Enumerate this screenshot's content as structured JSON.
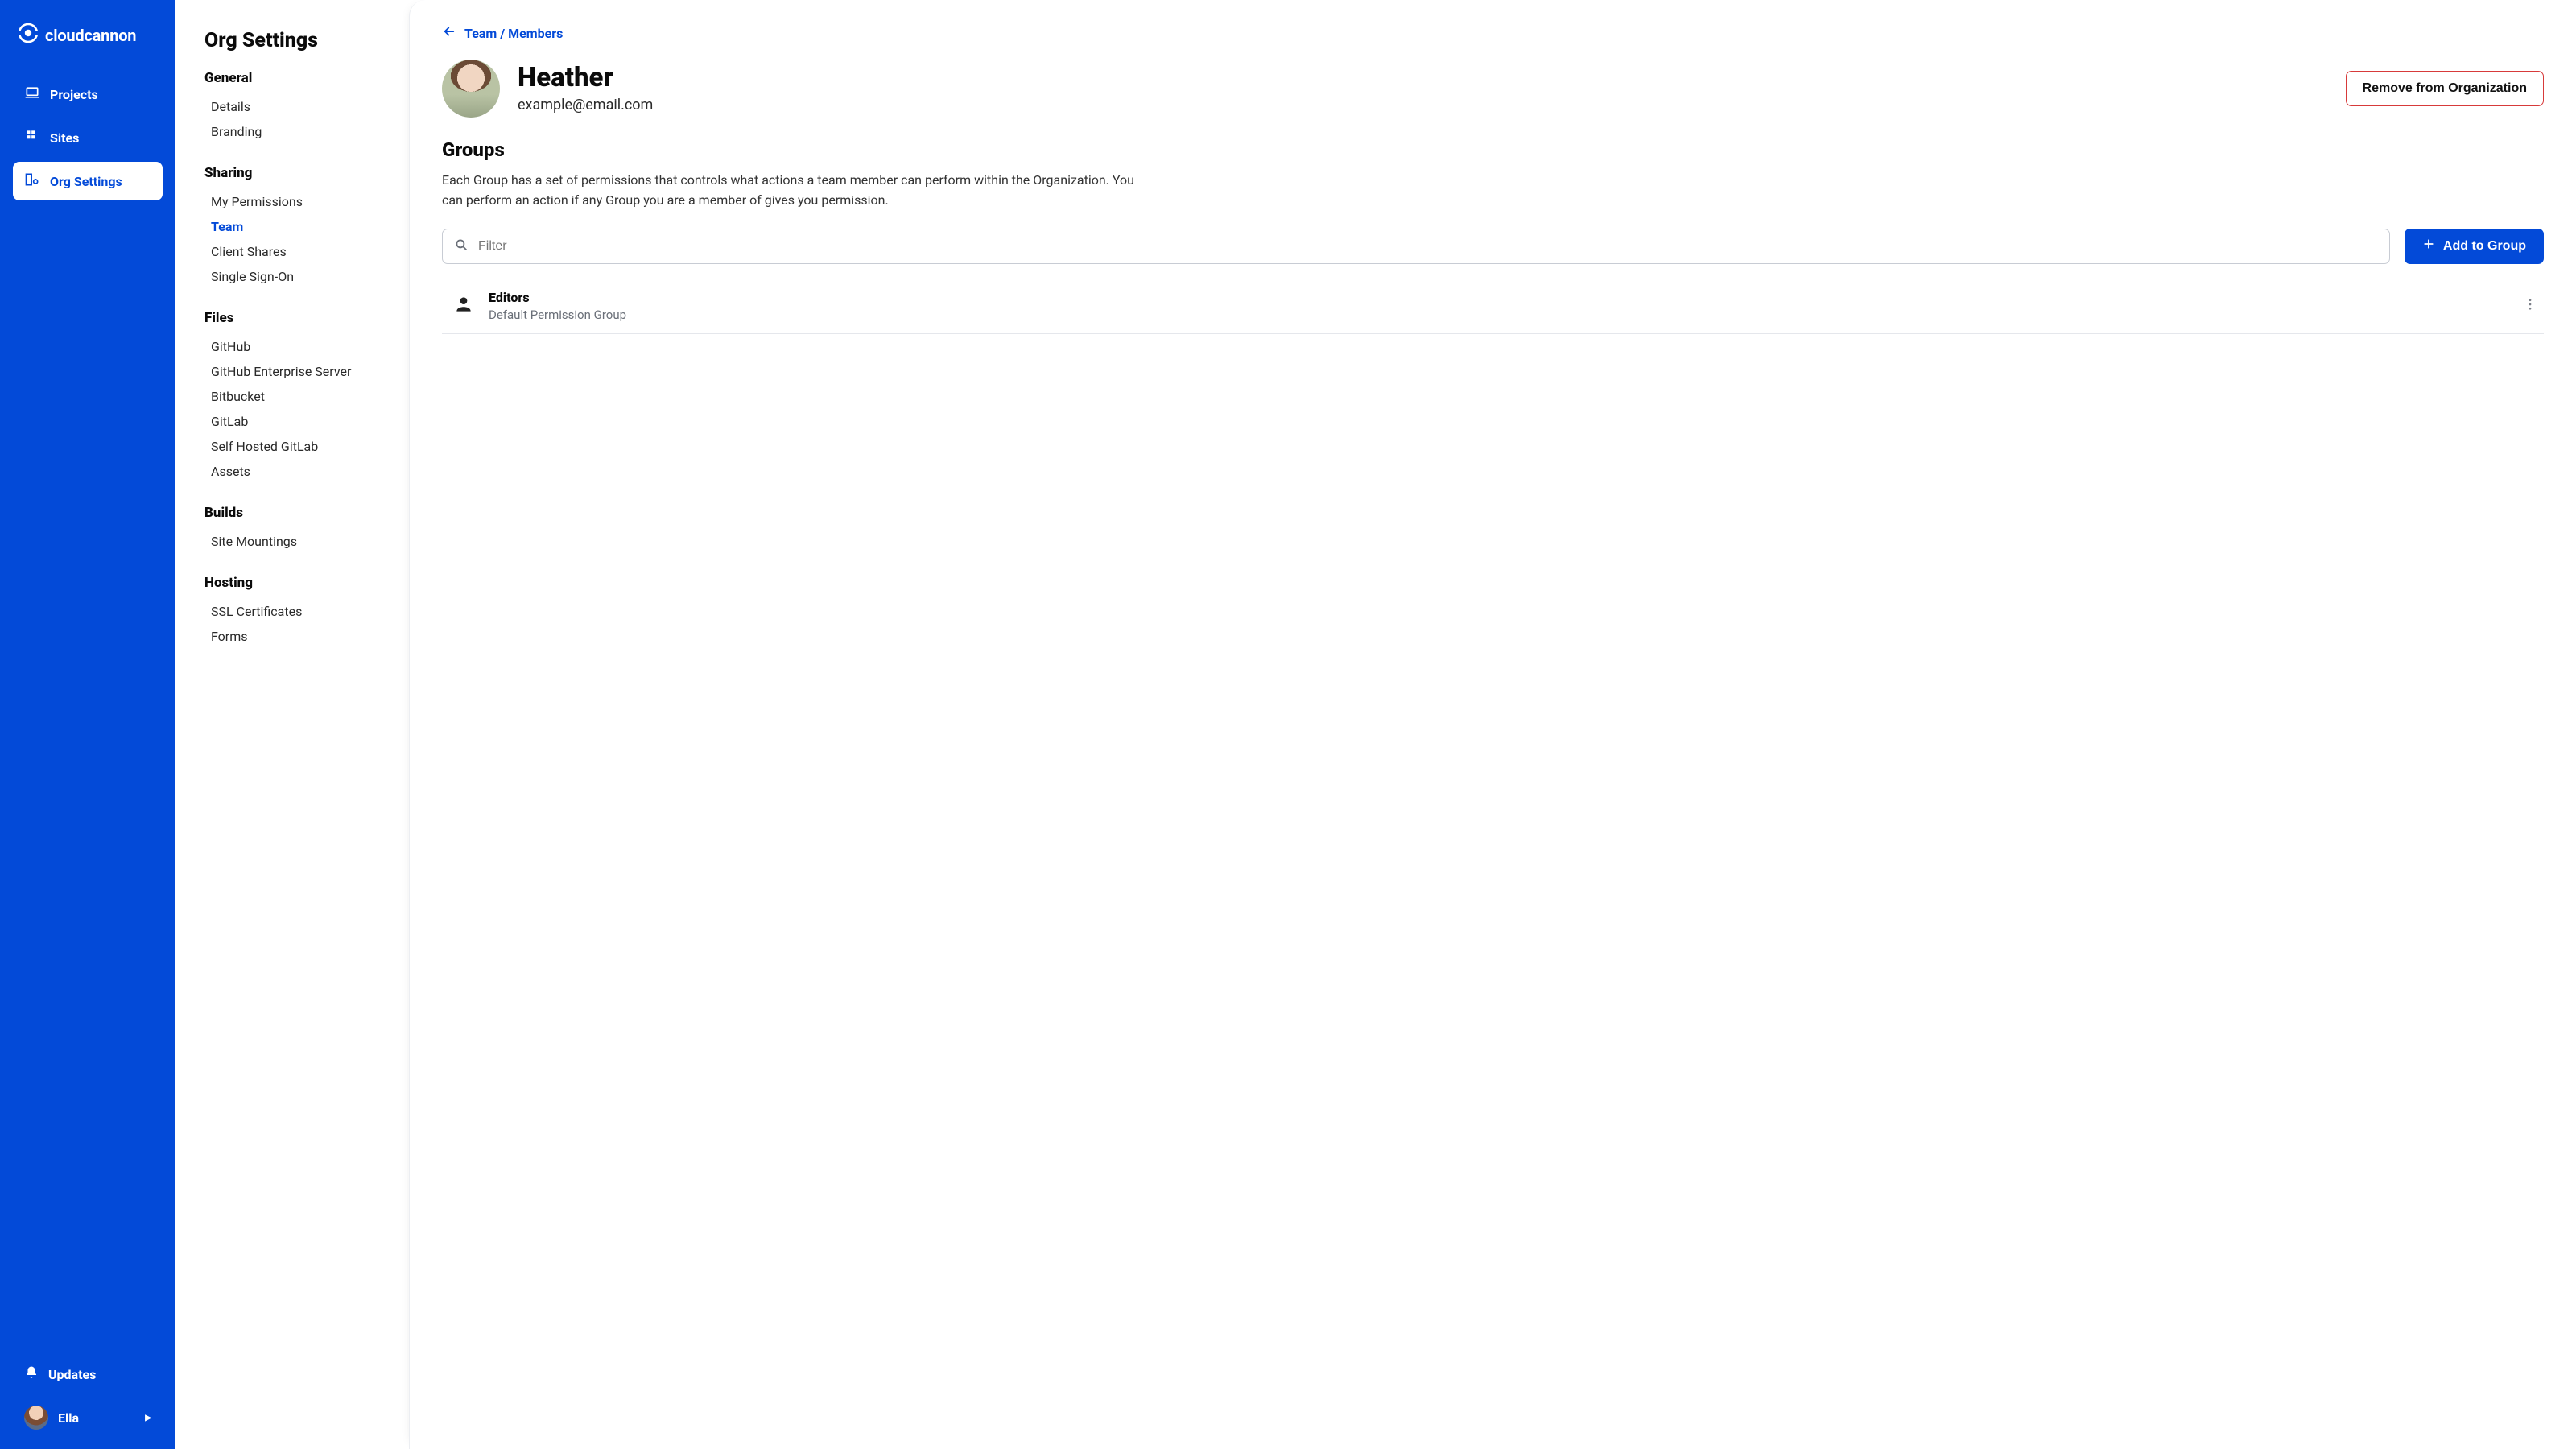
{
  "brand": {
    "name": "cloudcannon"
  },
  "primary_nav": {
    "items": [
      {
        "label": "Projects",
        "active": false
      },
      {
        "label": "Sites",
        "active": false
      },
      {
        "label": "Org Settings",
        "active": true
      }
    ]
  },
  "updates_label": "Updates",
  "current_user": {
    "name": "Ella"
  },
  "settings_panel": {
    "title": "Org Settings",
    "groups": [
      {
        "title": "General",
        "links": [
          "Details",
          "Branding"
        ]
      },
      {
        "title": "Sharing",
        "links": [
          "My Permissions",
          "Team",
          "Client Shares",
          "Single Sign-On"
        ],
        "active_index": 1
      },
      {
        "title": "Files",
        "links": [
          "GitHub",
          "GitHub Enterprise Server",
          "Bitbucket",
          "GitLab",
          "Self Hosted GitLab",
          "Assets"
        ]
      },
      {
        "title": "Builds",
        "links": [
          "Site Mountings"
        ]
      },
      {
        "title": "Hosting",
        "links": [
          "SSL Certificates",
          "Forms"
        ]
      }
    ]
  },
  "breadcrumb": {
    "label": "Team / Members"
  },
  "member": {
    "name": "Heather",
    "email": "example@email.com",
    "remove_label": "Remove from Organization"
  },
  "groups": {
    "heading": "Groups",
    "description": "Each Group has a set of permissions that controls what actions a team member can perform within the Organization. You can perform an action if any Group you are a member of gives you permission.",
    "filter_placeholder": "Filter",
    "add_label": "Add to Group",
    "items": [
      {
        "name": "Editors",
        "subtitle": "Default Permission Group"
      }
    ]
  }
}
